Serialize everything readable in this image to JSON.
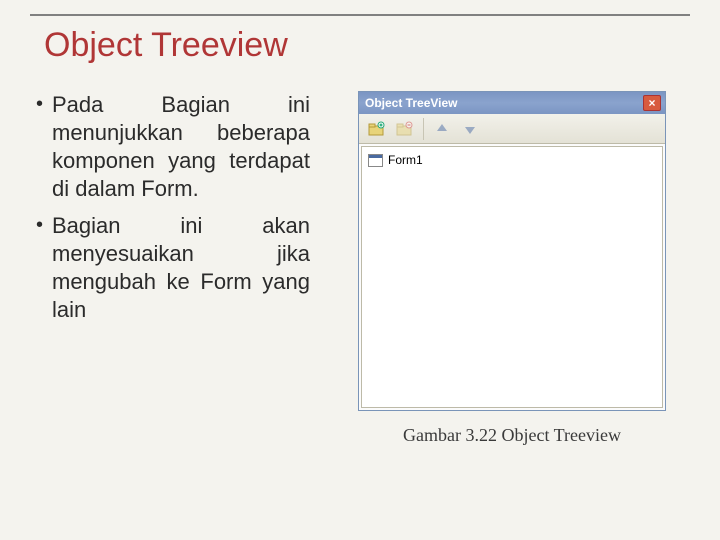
{
  "title": "Object Treeview",
  "bullets": [
    "Pada Bagian ini menunjukkan beberapa komponen yang terdapat di dalam Form.",
    "Bagian ini akan menyesuaikan jika mengubah ke Form yang lain"
  ],
  "panel": {
    "titlebar": "Object TreeView",
    "close": "×",
    "tree_item": "Form1"
  },
  "caption": "Gambar 3.22 Object Treeview"
}
